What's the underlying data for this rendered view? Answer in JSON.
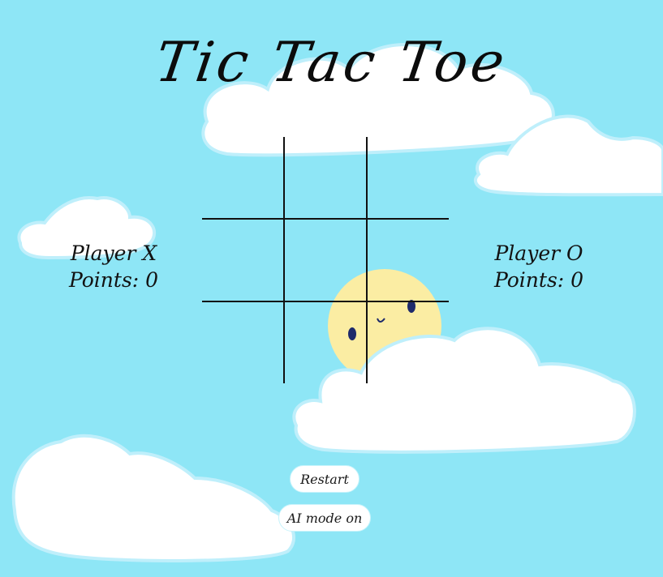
{
  "game": {
    "title": "Tic Tac Toe",
    "board": [
      [
        "",
        "",
        ""
      ],
      [
        "",
        "",
        ""
      ],
      [
        "",
        "",
        ""
      ]
    ]
  },
  "players": {
    "x": {
      "name": "Player X",
      "points_label": "Points: 0"
    },
    "o": {
      "name": "Player O",
      "points_label": "Points: 0"
    }
  },
  "controls": {
    "restart_label": "Restart",
    "ai_mode_label": "AI mode on"
  },
  "colors": {
    "sky": "#8ee6f6",
    "cloud": "#ffffff",
    "sun": "#fbeda3",
    "lines": "#111111"
  }
}
